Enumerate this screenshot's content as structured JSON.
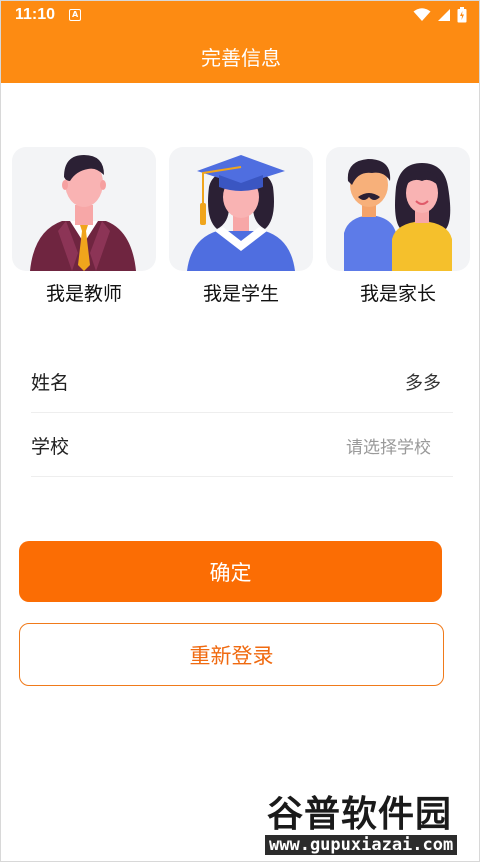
{
  "status_bar": {
    "time": "11:10",
    "notification_icon": "a-icon",
    "wifi_icon": "wifi-icon",
    "signal_icon": "signal-icon",
    "battery_icon": "battery-icon"
  },
  "app_bar": {
    "title": "完善信息"
  },
  "roles": [
    {
      "label": "我是教师",
      "icon": "teacher-avatar"
    },
    {
      "label": "我是学生",
      "icon": "graduate-student-avatar"
    },
    {
      "label": "我是家长",
      "icon": "parents-avatar"
    }
  ],
  "form": {
    "name_label": "姓名",
    "name_value": "多多",
    "school_label": "学校",
    "school_placeholder": "请选择学校"
  },
  "buttons": {
    "confirm_label": "确定",
    "relogin_label": "重新登录"
  },
  "watermark": {
    "title": "谷普软件园",
    "url": "www.gupuxiazai.com"
  },
  "colors": {
    "header": "#fd8b12",
    "confirm_button": "#fb6d04",
    "relogin_border": "#f07a1a"
  }
}
